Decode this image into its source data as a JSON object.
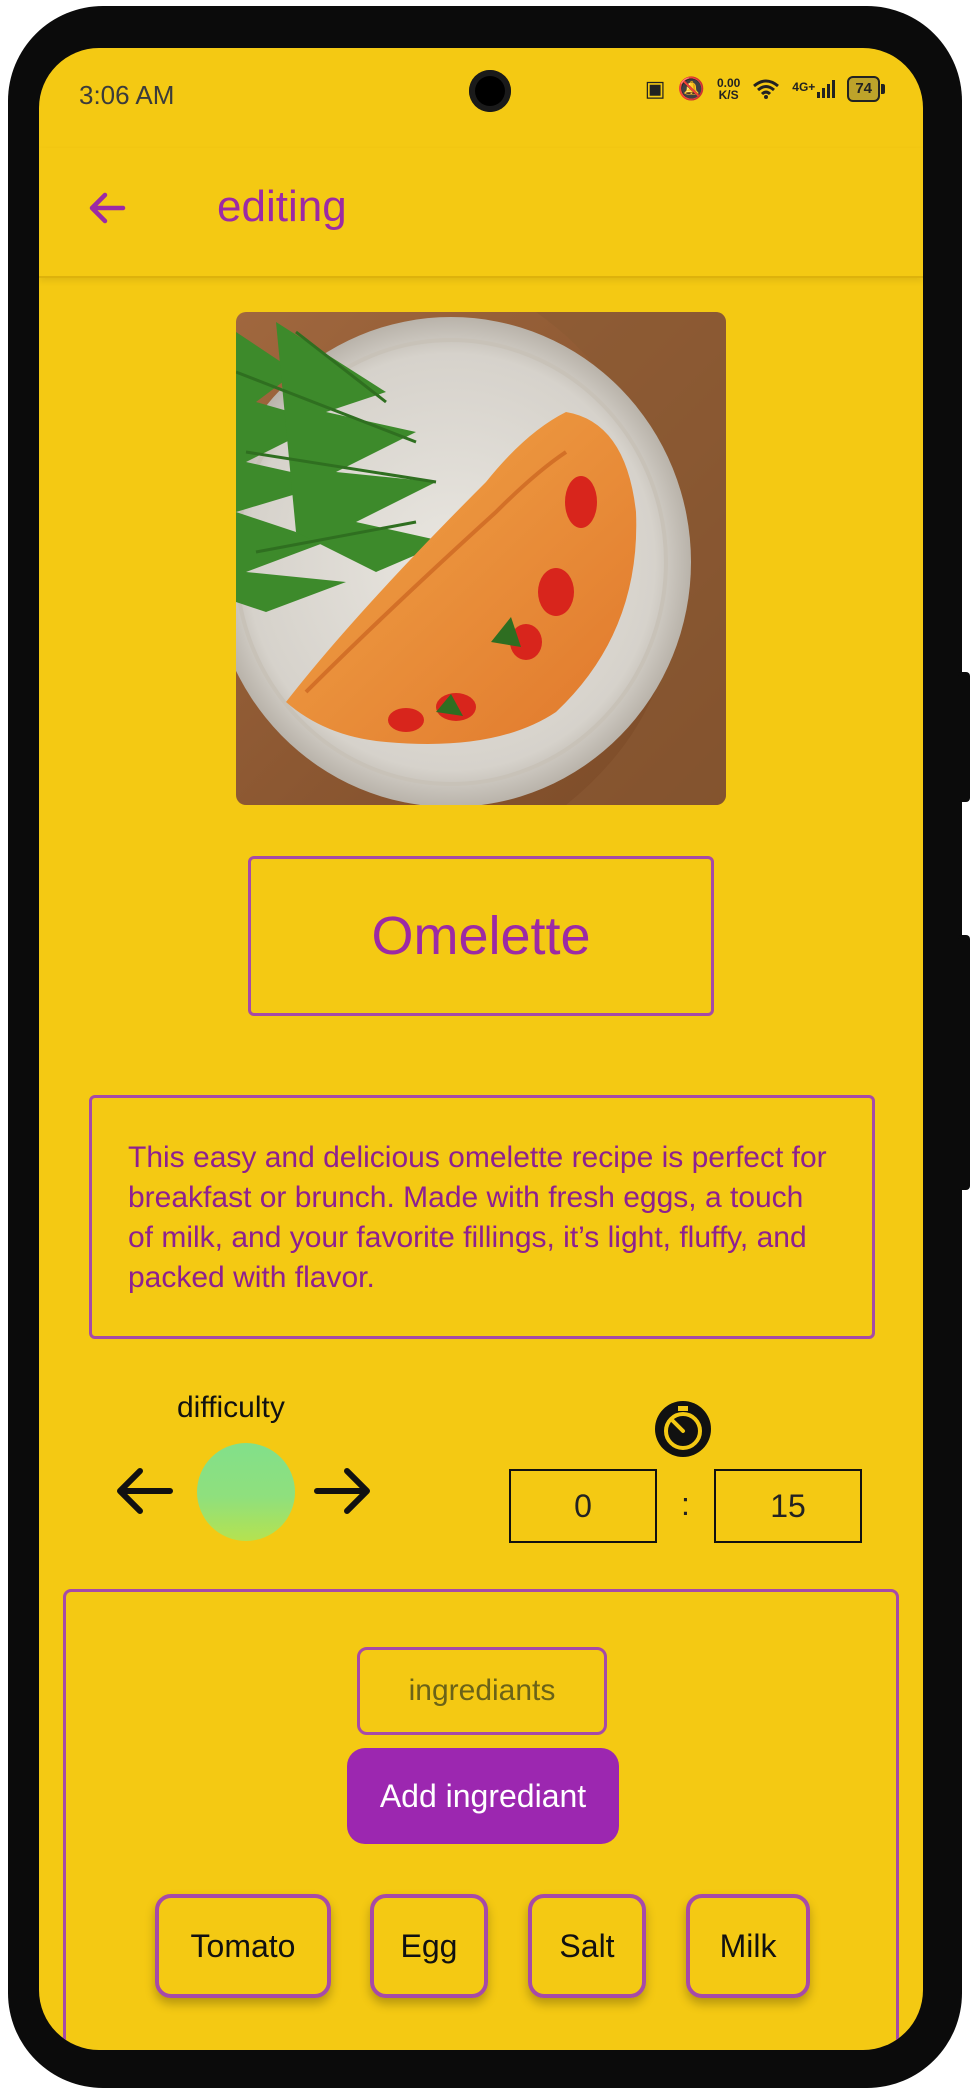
{
  "status_bar": {
    "time": "3:06 AM",
    "net_speed_value": "0.00",
    "net_speed_unit": "K/S",
    "network": "4G+",
    "battery": "74"
  },
  "app_bar": {
    "title": "editing"
  },
  "recipe": {
    "name": "Omelette",
    "description": "This easy and delicious omelette recipe is perfect for breakfast or brunch. Made with fresh eggs, a touch of milk, and your favorite fillings, it’s light, fluffy, and packed with flavor."
  },
  "difficulty": {
    "label": "difficulty"
  },
  "timer": {
    "hours": "0",
    "separator": ":",
    "minutes": "15"
  },
  "ingredients": {
    "input_placeholder": "ingrediants",
    "add_button": "Add ingrediant",
    "chips": [
      "Tomato",
      "Egg",
      "Salt",
      "Milk"
    ]
  },
  "colors": {
    "background": "#F4C913",
    "accent": "#9C27B0",
    "border": "#A64AA8"
  }
}
